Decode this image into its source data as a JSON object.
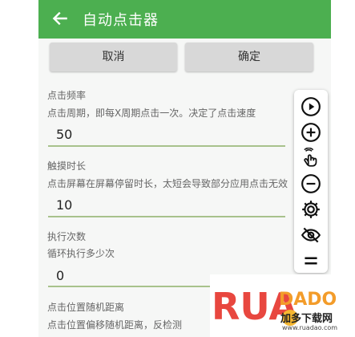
{
  "header": {
    "title": "自动点击器"
  },
  "actions": {
    "cancel_label": "取消",
    "confirm_label": "确定"
  },
  "settings": [
    {
      "label": "点击频率",
      "description": "点击周期，即每X周期点击一次。决定了点击速度",
      "value": "50",
      "hint": "M"
    },
    {
      "label": "触摸时长",
      "description": "点击屏幕在屏幕停留时长，太短会导致部分应用点击无效",
      "value": "10",
      "hint": "M"
    },
    {
      "label": "执行次数",
      "description": "循环执行多少次",
      "value": "0"
    },
    {
      "label": "点击位置随机距离",
      "description": "点击位置偏移随机距离，反检测"
    }
  ],
  "floating_toolbar": {
    "icons": [
      "play-icon",
      "plus-icon",
      "tap-hand-icon",
      "minus-icon",
      "gear-icon",
      "eye-off-icon",
      "menu-icon"
    ]
  },
  "watermark": {
    "brand": "RUADADO",
    "name": "加多下载网",
    "url": "www.ruadao.com"
  },
  "colors": {
    "appbar": "#4caf50",
    "underline": "#a8c28c",
    "button": "#d8d8d8"
  }
}
